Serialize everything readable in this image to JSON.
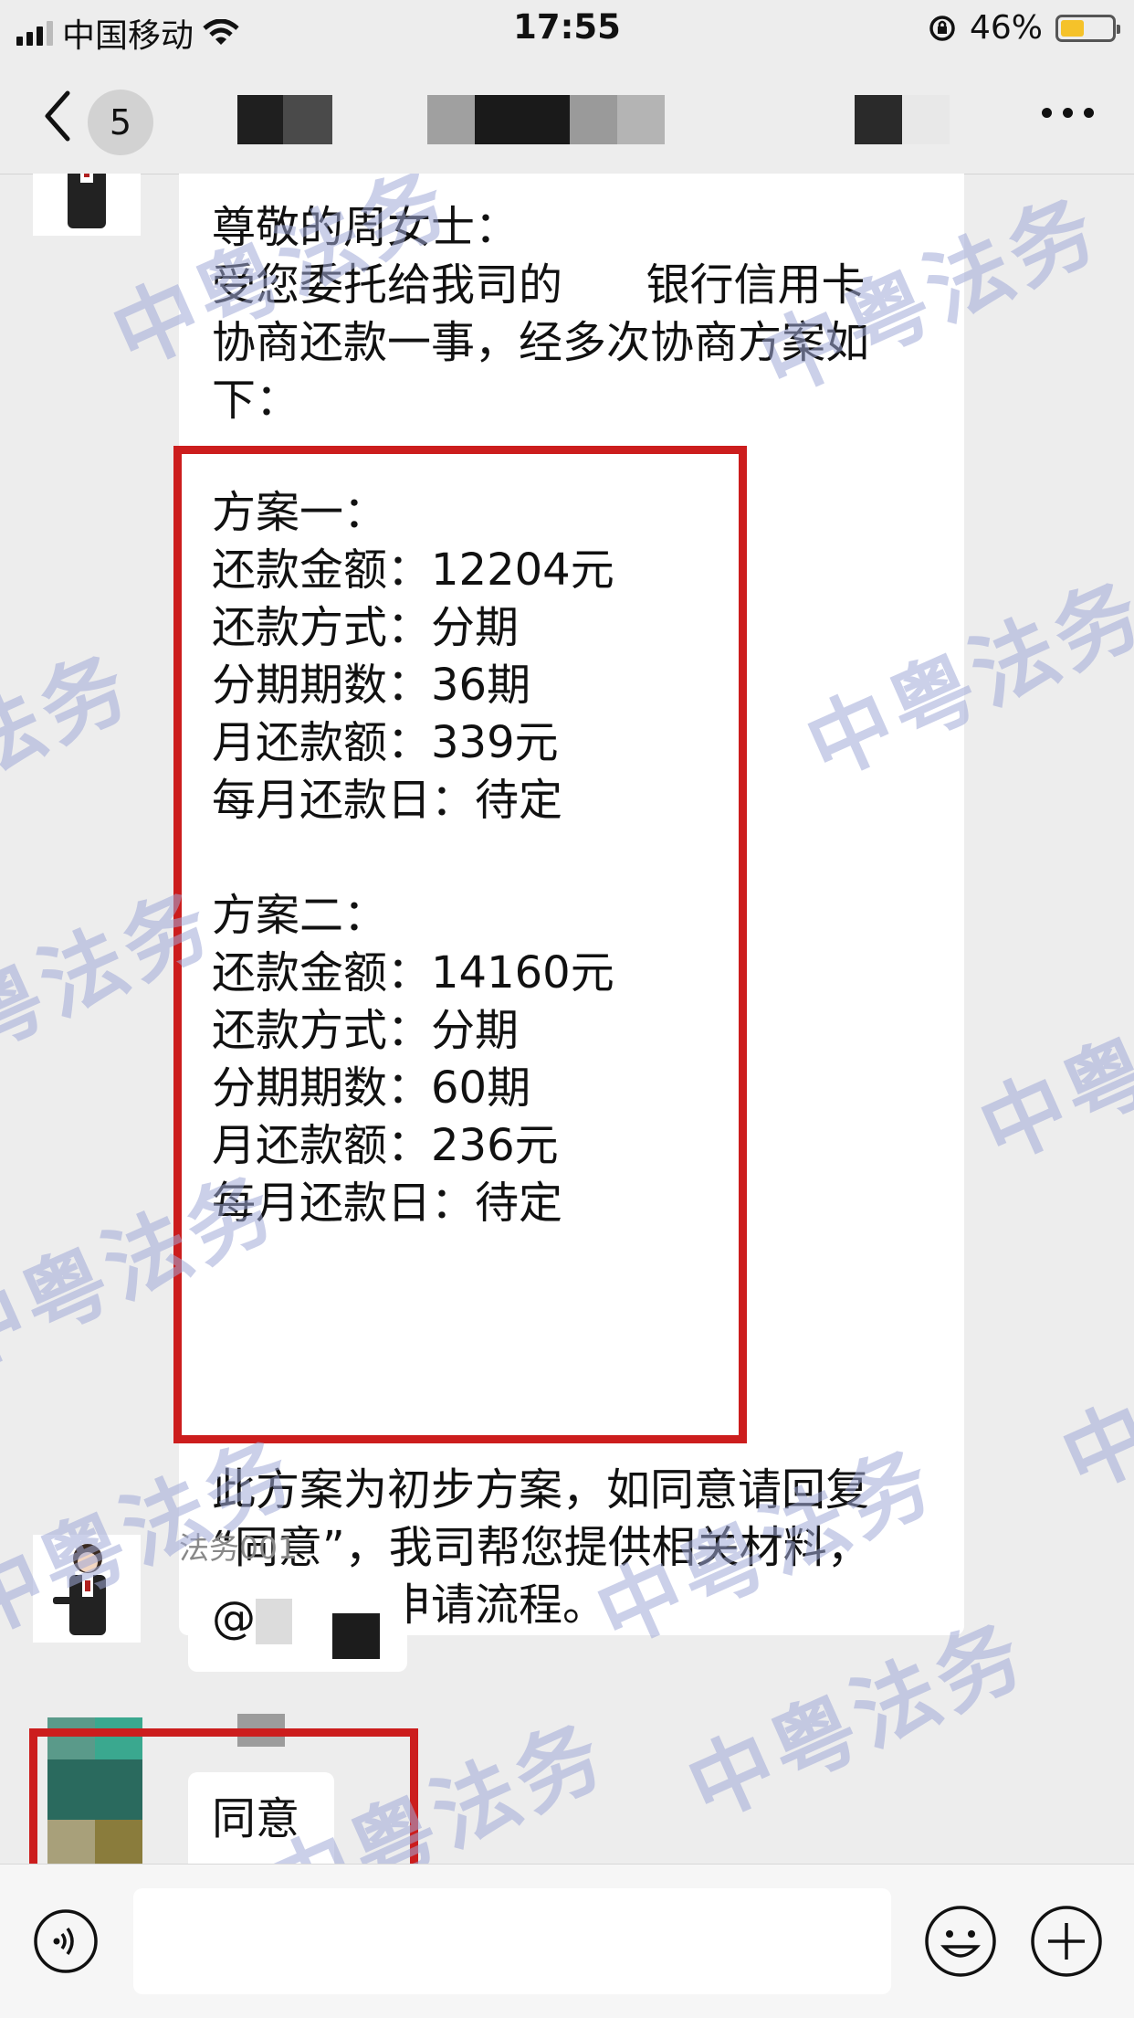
{
  "status_bar": {
    "carrier": "中国移动",
    "time": "17:55",
    "battery": "46%",
    "battery_level": 0.46
  },
  "nav": {
    "unread_count": "5"
  },
  "watermark": "中粤法务",
  "messages": {
    "first": {
      "intro": "尊敬的周女士：\n受您委托给我司的      银行信用卡\n协商还款一事，经多次协商方案如\n下：",
      "plans": "方案一：\n还款金额：12204元\n还款方式：分期\n分期期数：36期\n月还款额：339元\n每月还款日：待定\n\n方案二：\n还款金额：14160元\n还款方式：分期\n分期期数：60期\n月还款额：236元\n每月还款日：待定",
      "closing": "此方案为初步方案，如同意请回复\n“同意”，我司帮您提供相关材料，\n走下一步申请流程。"
    },
    "second": {
      "sender": "法务001",
      "text": "@"
    },
    "third": {
      "text": "同意"
    }
  },
  "colors": {
    "highlight": "#cc1d1d",
    "watermark": "#a0aad7",
    "battery_fill": "#f5c22a"
  },
  "icons": {
    "back": "chevron-left-icon",
    "more": "more-dots-icon",
    "voice": "voice-icon",
    "emoji": "emoji-icon",
    "plus": "plus-icon"
  }
}
